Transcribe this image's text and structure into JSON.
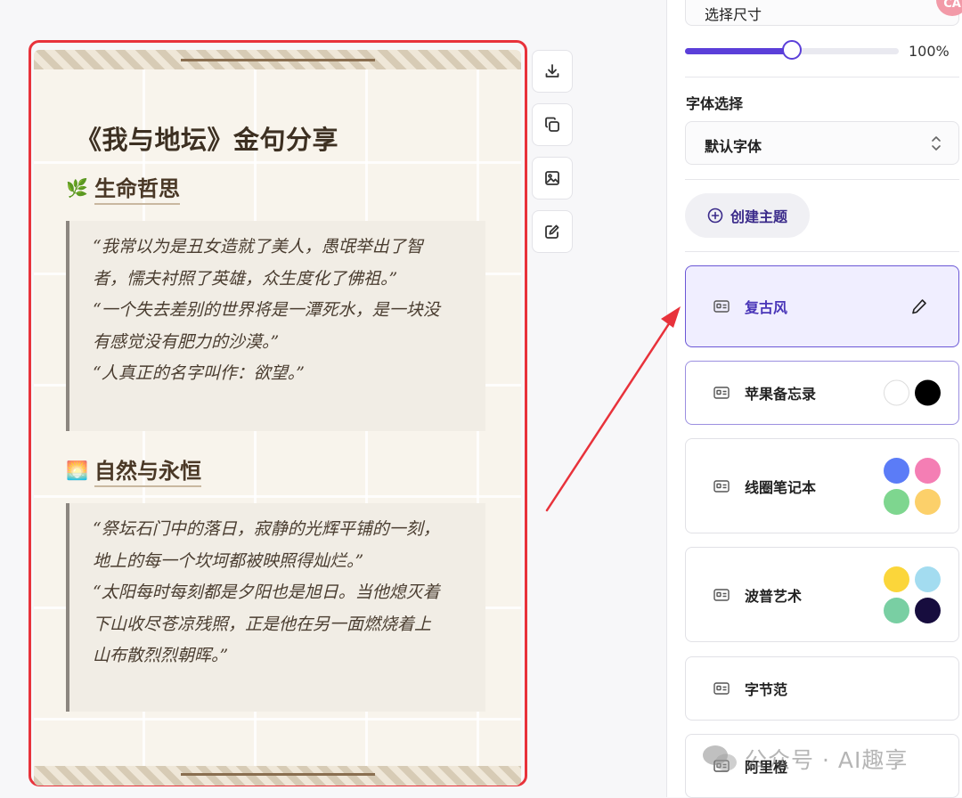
{
  "preview": {
    "title": "《我与地坛》金句分享",
    "sections": [
      {
        "emoji": "🌿",
        "heading": "生命哲思",
        "lines": [
          "“我常以为是丑女造就了美人，愚氓举出了智",
          "者，懦夫衬照了英雄，众生度化了佛祖。”",
          "“一个失去差别的世界将是一潭死水，是一块没",
          "有感觉没有肥力的沙漠。”",
          "“人真正的名字叫作：欲望。”"
        ]
      },
      {
        "emoji": "🌅",
        "heading": "自然与永恒",
        "lines": [
          "“祭坛石门中的落日，寂静的光辉平铺的一刻，",
          "地上的每一个坎坷都被映照得灿烂。”",
          "“太阳每时每刻都是夕阳也是旭日。当他熄灭着",
          "下山收尽苍凉残照，正是他在另一面燃烧着上",
          "山布散烈烈朝晖。”"
        ]
      }
    ]
  },
  "toolbar": {
    "buttons": [
      {
        "name": "download-icon"
      },
      {
        "name": "copy-icon"
      },
      {
        "name": "image-icon"
      },
      {
        "name": "edit-icon"
      }
    ]
  },
  "panel": {
    "size_select_label": "选择尺寸",
    "avatar_text": "CA",
    "zoom_value": 1.0,
    "zoom_label": "100%",
    "font_section_label": "字体选择",
    "font_select_value": "默认字体",
    "create_theme_label": "创建主题",
    "accent_color": "#5b3fd9",
    "themes": [
      {
        "name": "复古风",
        "state": "selected",
        "colors": []
      },
      {
        "name": "苹果备忘录",
        "state": "outlined",
        "colors": [
          "#ffffff",
          "#000000"
        ]
      },
      {
        "name": "线圈笔记本",
        "state": "normal",
        "colors": [
          "#5b7cf7",
          "#f47eb4",
          "#7ed68f",
          "#fcd06a"
        ]
      },
      {
        "name": "波普艺术",
        "state": "normal",
        "colors": [
          "#fbd63a",
          "#a3dcf0",
          "#79cfa3",
          "#170d3e"
        ]
      },
      {
        "name": "字节范",
        "state": "normal",
        "colors": []
      },
      {
        "name": "阿里橙",
        "state": "normal",
        "colors": []
      }
    ]
  },
  "watermark": "公众号 · AI趣享"
}
